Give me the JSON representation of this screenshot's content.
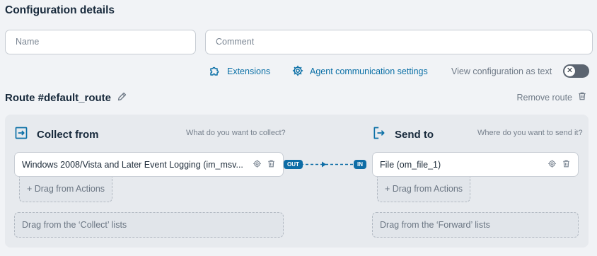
{
  "header": {
    "title": "Configuration details"
  },
  "form": {
    "name_placeholder": "Name",
    "comment_placeholder": "Comment"
  },
  "toolbar": {
    "extensions_label": "Extensions",
    "agent_settings_label": "Agent communication settings",
    "view_text_label": "View configuration as text",
    "view_text_toggle": "off"
  },
  "route": {
    "title": "Route #default_route",
    "remove_label": "Remove route",
    "collect": {
      "title": "Collect from",
      "hint": "What do you want to collect?",
      "node_label": "Windows 2008/Vista and Later Event Logging (im_msv...",
      "port_label": "OUT",
      "drag_actions_label": "+ Drag from Actions",
      "drop_zone_label": "Drag from the ‘Collect’ lists"
    },
    "send": {
      "title": "Send to",
      "hint": "Where do you want to send it?",
      "node_label": "File (om_file_1)",
      "port_label": "IN",
      "drag_actions_label": "+ Drag from Actions",
      "drop_zone_label": "Drag from the ‘Forward’ lists"
    }
  },
  "colors": {
    "accent": "#0a6fa6",
    "port": "#0e6da6",
    "panel": "#e7eaee",
    "background": "#f1f3f6"
  },
  "icons": {
    "extensions": "puzzle-icon",
    "agent_settings": "gear-icon",
    "edit": "pencil-icon",
    "remove": "trash-icon",
    "collect": "sign-in-icon",
    "send": "sign-out-icon"
  }
}
